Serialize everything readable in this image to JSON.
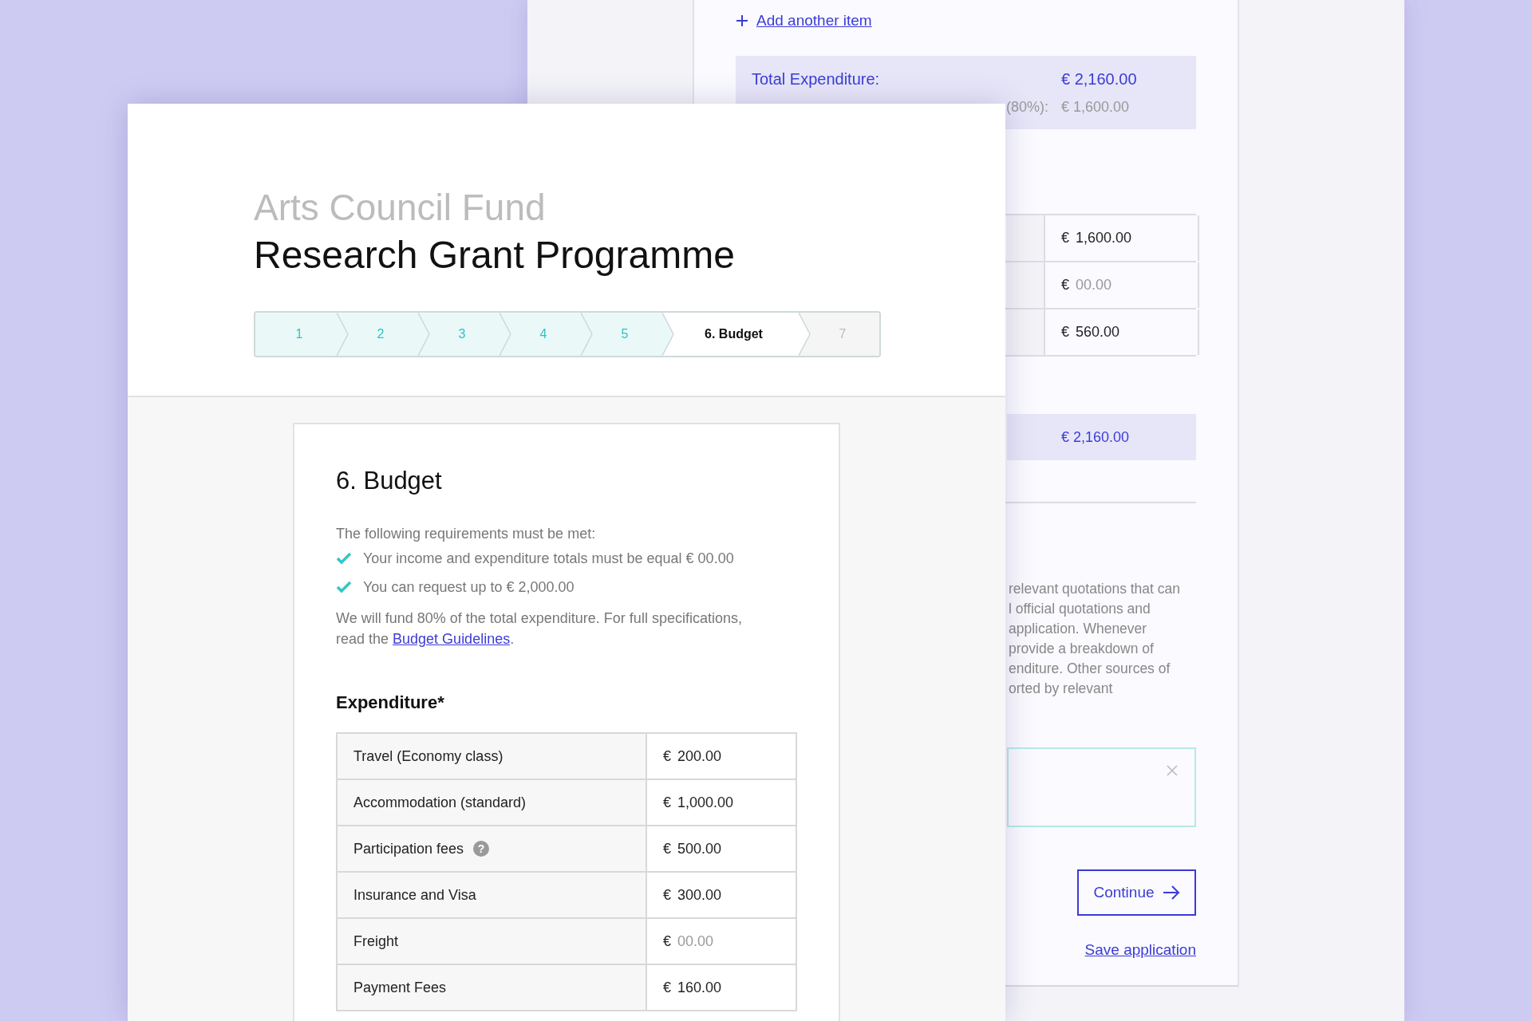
{
  "back_page": {
    "add_item_link": "Add another item",
    "totals": {
      "label": "Total Expenditure:",
      "value": "€ 2,160.00",
      "fund_label": "(80%):",
      "fund_value": "€ 1,600.00"
    },
    "table_rows": [
      {
        "currency": "€",
        "value": "1,600.00"
      },
      {
        "currency": "€",
        "placeholder": "00.00"
      },
      {
        "currency": "€",
        "value": "560.00"
      }
    ],
    "total_row_value": "€ 2,160.00",
    "guidance_lines": [
      "relevant quotations that can",
      "l official quotations and",
      "application. Whenever",
      "provide a breakdown of",
      "enditure. Other sources of",
      "orted by relevant"
    ],
    "continue_button": "Continue",
    "save_link": "Save application"
  },
  "front_page": {
    "fund_name": "Arts Council Fund",
    "programme_title": "Research Grant Programme",
    "steps": [
      {
        "label": "1",
        "completed": true,
        "selected": false
      },
      {
        "label": "2",
        "completed": true,
        "selected": false
      },
      {
        "label": "3",
        "completed": true,
        "selected": false
      },
      {
        "label": "4",
        "completed": true,
        "selected": false
      },
      {
        "label": "5",
        "completed": true,
        "selected": false
      },
      {
        "label": "6. Budget",
        "completed": false,
        "selected": true
      },
      {
        "label": "7",
        "completed": false,
        "selected": false
      }
    ],
    "section_title": "6. Budget",
    "intro": "The following requirements must be met:",
    "requirements": [
      {
        "text": "Your income and expenditure totals must be equal € 00.00",
        "met": true
      },
      {
        "text": "You can request up to € 2,000.00",
        "met": true
      }
    ],
    "note_before": "We will fund 80% of the total expenditure. For full specifications, read the ",
    "note_link": "Budget Guidelines",
    "note_after": ".",
    "expenditure_heading": "Expenditure*",
    "expenditure_rows": [
      {
        "label": "Travel (Economy class)",
        "currency": "€",
        "value": "200.00"
      },
      {
        "label": "Accommodation (standard)",
        "currency": "€",
        "value": "1,000.00"
      },
      {
        "label": "Participation fees",
        "help": "?",
        "currency": "€",
        "value": "500.00"
      },
      {
        "label": "Insurance and Visa",
        "currency": "€",
        "value": "300.00"
      },
      {
        "label": "Freight",
        "currency": "€",
        "placeholder": "00.00"
      },
      {
        "label": "Payment Fees",
        "currency": "€",
        "value": "160.00"
      }
    ]
  }
}
